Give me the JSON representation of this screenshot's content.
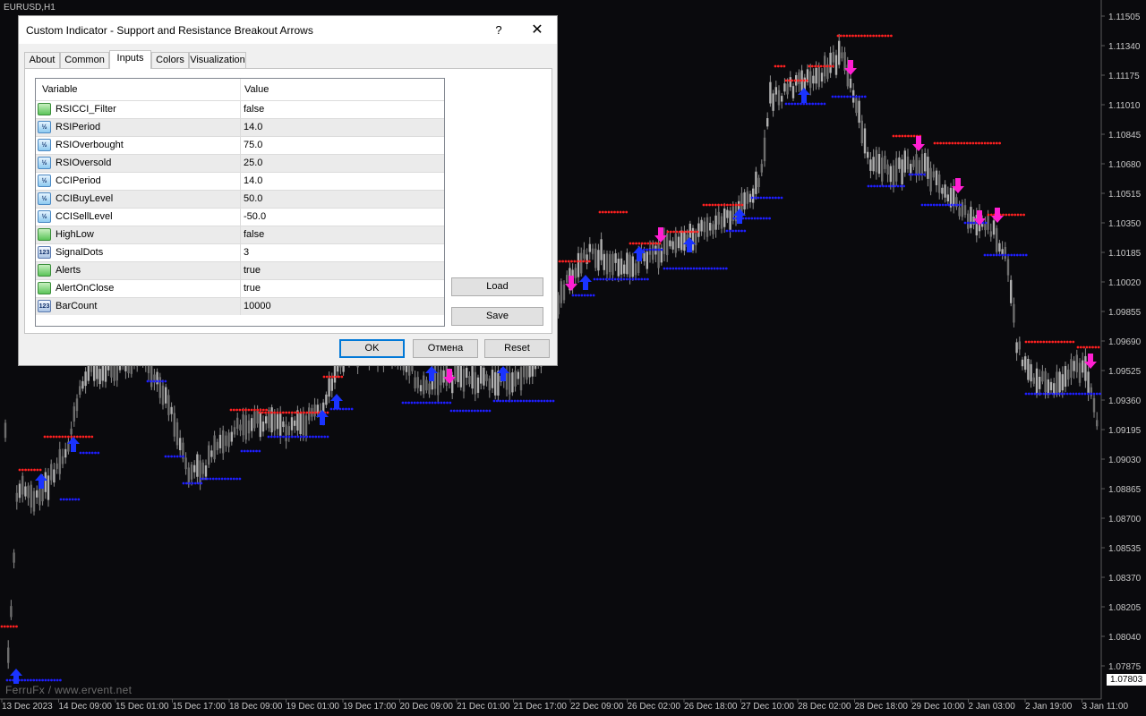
{
  "chart": {
    "symbol": "EURUSD,H1",
    "watermark": "FerruFx / www.ervent.net",
    "current_price": "1.07803",
    "price_axis": [
      "1.11505",
      "1.11340",
      "1.11175",
      "1.11010",
      "1.10845",
      "1.10680",
      "1.10515",
      "1.10350",
      "1.10185",
      "1.10020",
      "1.09855",
      "1.09690",
      "1.09525",
      "1.09360",
      "1.09195",
      "1.09030",
      "1.08865",
      "1.08700",
      "1.08535",
      "1.08370",
      "1.08205",
      "1.08040",
      "1.07875"
    ],
    "time_axis": [
      "13 Dec 2023",
      "14 Dec 09:00",
      "15 Dec 01:00",
      "15 Dec 17:00",
      "18 Dec 09:00",
      "19 Dec 01:00",
      "19 Dec 17:00",
      "20 Dec 09:00",
      "21 Dec 01:00",
      "21 Dec 17:00",
      "22 Dec 09:00",
      "26 Dec 02:00",
      "26 Dec 18:00",
      "27 Dec 10:00",
      "28 Dec 02:00",
      "28 Dec 18:00",
      "29 Dec 10:00",
      "2 Jan 03:00",
      "2 Jan 19:00",
      "3 Jan 11:00"
    ],
    "colors": {
      "background": "#0a0a0d",
      "candle": "#8c8c8c",
      "resistance": "#ff2020",
      "support": "#1e1eff",
      "up_arrow": "#1a33ff",
      "down_arrow": "#ff1fd2"
    }
  },
  "dialog": {
    "title": "Custom Indicator - Support and Resistance Breakout Arrows",
    "help_label": "?",
    "close_label": "✕",
    "tabs": [
      {
        "label": "About"
      },
      {
        "label": "Common"
      },
      {
        "label": "Inputs"
      },
      {
        "label": "Colors"
      },
      {
        "label": "Visualization"
      }
    ],
    "active_tab": "Inputs",
    "columns": {
      "variable": "Variable",
      "value": "Value"
    },
    "inputs": [
      {
        "name": "RSICCI_Filter",
        "value": "false",
        "icon": "bool-icon",
        "icon_text": ""
      },
      {
        "name": "RSIPeriod",
        "value": "14.0",
        "icon": "double-icon",
        "icon_text": "½"
      },
      {
        "name": "RSIOverbought",
        "value": "75.0",
        "icon": "double-icon",
        "icon_text": "½"
      },
      {
        "name": "RSIOversold",
        "value": "25.0",
        "icon": "double-icon",
        "icon_text": "½"
      },
      {
        "name": "CCIPeriod",
        "value": "14.0",
        "icon": "double-icon",
        "icon_text": "½"
      },
      {
        "name": "CCIBuyLevel",
        "value": "50.0",
        "icon": "double-icon",
        "icon_text": "½"
      },
      {
        "name": "CCISellLevel",
        "value": "-50.0",
        "icon": "double-icon",
        "icon_text": "½"
      },
      {
        "name": "HighLow",
        "value": "false",
        "icon": "bool-icon",
        "icon_text": ""
      },
      {
        "name": "SignalDots",
        "value": "3",
        "icon": "int-icon",
        "icon_text": "123"
      },
      {
        "name": "Alerts",
        "value": "true",
        "icon": "bool-icon",
        "icon_text": ""
      },
      {
        "name": "AlertOnClose",
        "value": "true",
        "icon": "bool-icon",
        "icon_text": ""
      },
      {
        "name": "BarCount",
        "value": "10000",
        "icon": "int-icon",
        "icon_text": "123"
      }
    ],
    "buttons": {
      "load": "Load",
      "save": "Save",
      "ok": "OK",
      "cancel": "Отмена",
      "reset": "Reset"
    }
  }
}
